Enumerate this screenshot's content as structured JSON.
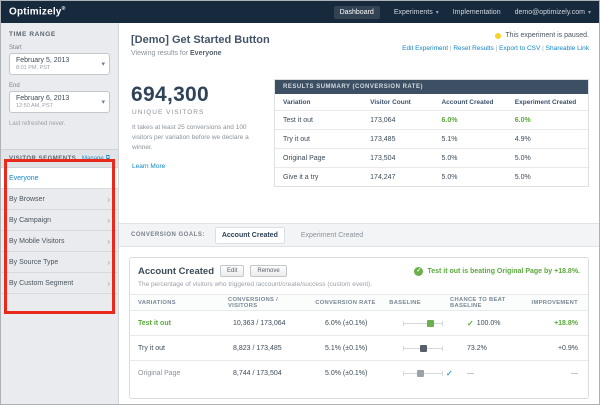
{
  "icons": {
    "chevron_down": "▾",
    "chevron_right": "›",
    "check": "✓",
    "external_link": "⧉"
  },
  "navbar": {
    "brand": "Optimizely",
    "items": [
      "Dashboard",
      "Experiments",
      "Implementation",
      "demo@optimizely.com"
    ]
  },
  "sidebar": {
    "time_range": {
      "title": "TIME RANGE",
      "start_label": "Start",
      "start_value": "February 5, 2013",
      "start_sub": "8:01 PM, PST",
      "end_label": "End",
      "end_value": "February 6, 2013",
      "end_sub": "12:50 AM, PST",
      "refreshed": "Last refreshed never."
    },
    "segments": {
      "title": "VISITOR SEGMENTS",
      "manage": "Manage",
      "items": [
        "Everyone",
        "By Browser",
        "By Campaign",
        "By Mobile Visitors",
        "By Source Type",
        "By Custom Segment"
      ]
    }
  },
  "main": {
    "title": "[Demo] Get Started Button",
    "subtitle_prefix": "Viewing results for ",
    "subtitle_bold": "Everyone",
    "status": "This experiment is paused.",
    "links": [
      "Edit Experiment",
      "Reset Results",
      "Export to CSV",
      "Shareable Link"
    ],
    "visitors": {
      "count": "694,300",
      "label": "UNIQUE VISITORS",
      "note": "It takes at least 25 conversions and 100 visitors per variation before we declare a winner.",
      "learn_more": "Learn More"
    },
    "summary": {
      "title": "RESULTS SUMMARY (CONVERSION RATE)",
      "col1": "Variation",
      "col2": "Visitor Count",
      "col3": "Account Created",
      "col4": "Experiment Created",
      "rows": [
        {
          "variation": "Test it out",
          "visitors": "173,064",
          "account": "6.0%",
          "experiment": "6.0%"
        },
        {
          "variation": "Try it out",
          "visitors": "173,485",
          "account": "5.1%",
          "experiment": "4.9%"
        },
        {
          "variation": "Original Page",
          "visitors": "173,504",
          "account": "5.0%",
          "experiment": "5.0%"
        },
        {
          "variation": "Give it a try",
          "visitors": "174,247",
          "account": "5.0%",
          "experiment": "5.0%"
        }
      ]
    },
    "goals": {
      "label": "CONVERSION GOALS:",
      "tab1": "Account Created",
      "tab2": "Experiment Created"
    },
    "goal_panel": {
      "title": "Account Created",
      "edit": "Edit",
      "remove": "Remove",
      "description": "The percentage of visitors who triggered /account/create/success (custom event).",
      "banner": "Test it out is beating Original Page by +18.8%.",
      "col1": "VARIATIONS",
      "col2": "CONVERSIONS / VISITORS",
      "col3": "CONVERSION RATE",
      "col4": "BASELINE",
      "col5": "CHANCE TO BEAT BASELINE",
      "col6": "IMPROVEMENT",
      "rows": [
        {
          "name": "Test it out",
          "conv": "10,363 / 173,064",
          "rate": "6.0% (±0.1%)",
          "chance": "100.0%",
          "improvement": "+18.8%"
        },
        {
          "name": "Try it out",
          "conv": "8,823 / 173,485",
          "rate": "5.1% (±0.1%)",
          "chance": "73.2%",
          "improvement": "+0.9%"
        },
        {
          "name": "Original Page",
          "conv": "8,744 / 173,504",
          "rate": "5.0% (±0.1%)",
          "chance": "—",
          "improvement": "—"
        }
      ]
    }
  }
}
